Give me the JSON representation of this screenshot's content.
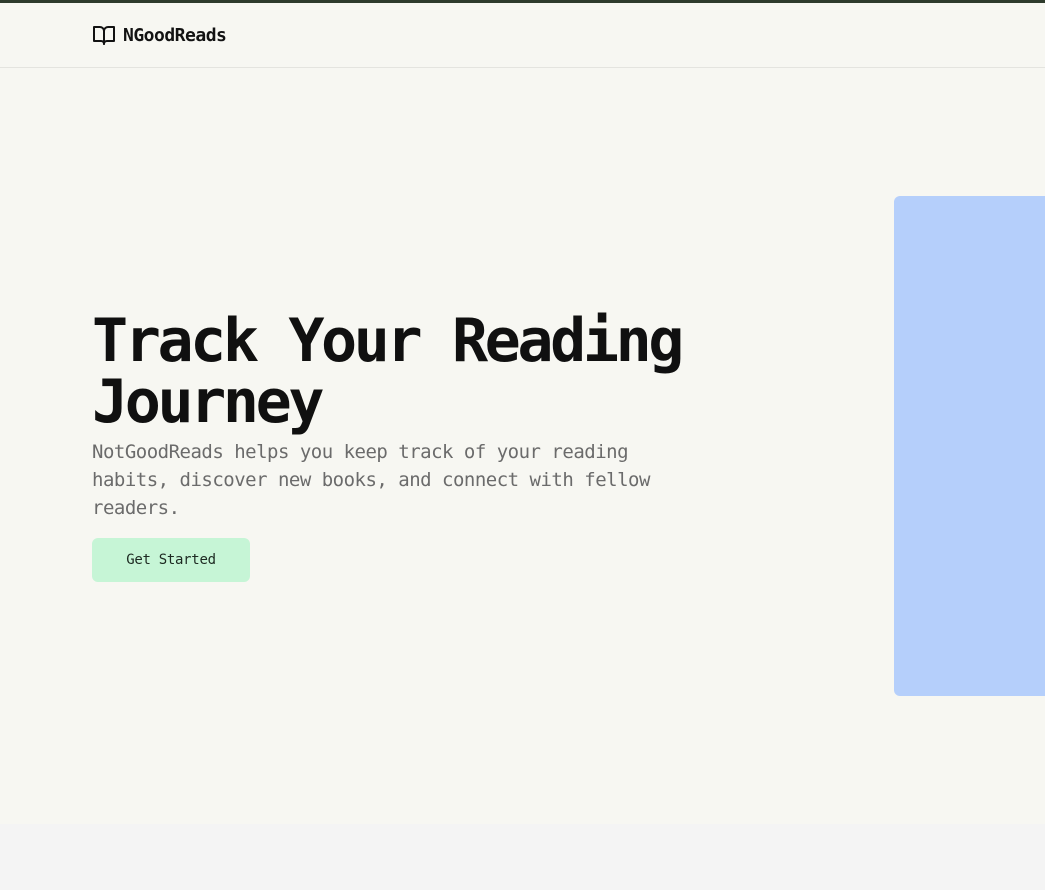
{
  "header": {
    "brand_name": "NGoodReads",
    "brand_icon": "book-open-icon"
  },
  "hero": {
    "title_line1": "Track Your Reading",
    "title_line2": "Journey",
    "description": "NotGoodReads helps you keep track of your reading habits, discover new books, and connect with fellow readers.",
    "cta_label": "Get Started"
  },
  "colors": {
    "top_strip": "#2e3b2c",
    "background": "#f7f7f2",
    "cta_background": "#c6f5d6",
    "hero_panel": "#b5cffb",
    "footer_background": "#f4f4f4"
  }
}
